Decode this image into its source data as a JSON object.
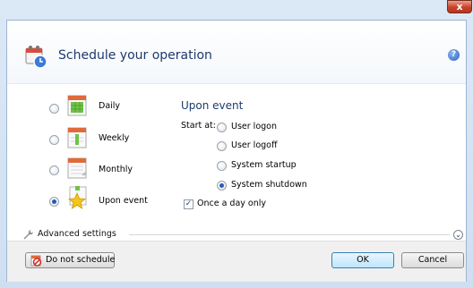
{
  "window": {
    "close_glyph": "x"
  },
  "header": {
    "title": "Schedule your operation",
    "help_glyph": "?"
  },
  "options": [
    {
      "label": "Daily",
      "selected": false,
      "icon": "calendar-daily-icon"
    },
    {
      "label": "Weekly",
      "selected": false,
      "icon": "calendar-weekly-icon"
    },
    {
      "label": "Monthly",
      "selected": false,
      "icon": "calendar-monthly-icon"
    },
    {
      "label": "Upon event",
      "selected": true,
      "icon": "star-event-icon"
    }
  ],
  "event": {
    "title": "Upon event",
    "start_at_label": "Start at:",
    "choices": [
      {
        "label": "User logon",
        "selected": false
      },
      {
        "label": "User logoff",
        "selected": false
      },
      {
        "label": "System startup",
        "selected": false
      },
      {
        "label": "System shutdown",
        "selected": true
      }
    ],
    "once_a_day": {
      "label": "Once a day only",
      "checked": true
    }
  },
  "advanced": {
    "label": "Advanced settings",
    "glyph": "⌄"
  },
  "footer": {
    "do_not_schedule": "Do not schedule",
    "ok": "OK",
    "cancel": "Cancel"
  },
  "colors": {
    "title": "#1e3a6e",
    "radio_selected": "#2a5ab8",
    "close": "#c8422a"
  }
}
